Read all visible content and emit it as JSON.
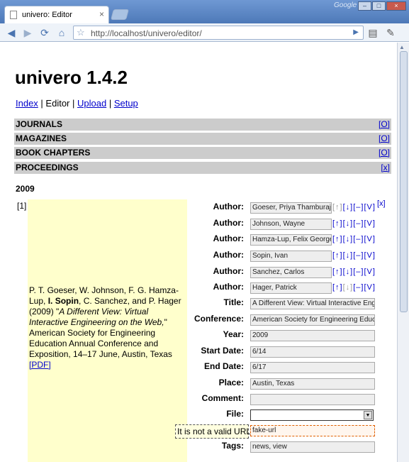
{
  "browser": {
    "tab_title": "univero: Editor",
    "tab_close": "×",
    "brand": "Google",
    "window_min": "–",
    "window_max": "□",
    "window_close": "×",
    "url": "http://localhost/univero/editor/"
  },
  "page": {
    "title": "univero 1.4.2",
    "nav": [
      {
        "label": "Index"
      },
      {
        "label": "Editor"
      },
      {
        "label": "Upload"
      },
      {
        "label": "Setup"
      }
    ],
    "categories": [
      {
        "label": "JOURNALS",
        "toggle": "[O]"
      },
      {
        "label": "MAGAZINES",
        "toggle": "[O]"
      },
      {
        "label": "BOOK CHAPTERS",
        "toggle": "[O]"
      },
      {
        "label": "PROCEEDINGS",
        "toggle": "[x]"
      }
    ],
    "year": "2009",
    "entry": {
      "number": "[1]",
      "remove": "[x]",
      "citation": {
        "part1": "P. T. Goeser, W. Johnson, F. G. Hamza-Lup, ",
        "bold": "I. Sopin",
        "part2": ", C. Sanchez, and P. Hager (2009) \"",
        "title": "A Different View: Virtual Interactive Engineering on the Web,",
        "part3": "\" American Society for Engineering Education Annual Conference and Exposition, 14–17 June, Austin, Texas ",
        "link": "[PDF]"
      },
      "author_label": "Author:",
      "authors": [
        "Goeser, Priya Thamburaj",
        "Johnson, Wayne",
        "Hamza-Lup, Felix George",
        "Sopin, Ivan",
        "Sanchez, Carlos",
        "Hager, Patrick"
      ],
      "author_actions": {
        "up": "[↑]",
        "down": "[↓]",
        "minus": "[–]",
        "v": "[V]"
      },
      "fields": {
        "title_label": "Title:",
        "title": "A Different View: Virtual Interactive Engineering on the Web",
        "conference_label": "Conference:",
        "conference": "American Society for Engineering Education Annual Conference",
        "year_label": "Year:",
        "year": "2009",
        "start_label": "Start Date:",
        "start": "6/14",
        "end_label": "End Date:",
        "end": "6/17",
        "place_label": "Place:",
        "place": "Austin, Texas",
        "comment_label": "Comment:",
        "comment": "",
        "file_label": "File:",
        "file": "",
        "url_value": "fake-url",
        "url_error": "It is not a valid URL:",
        "tags_label": "Tags:",
        "tags": "news, view"
      }
    }
  }
}
